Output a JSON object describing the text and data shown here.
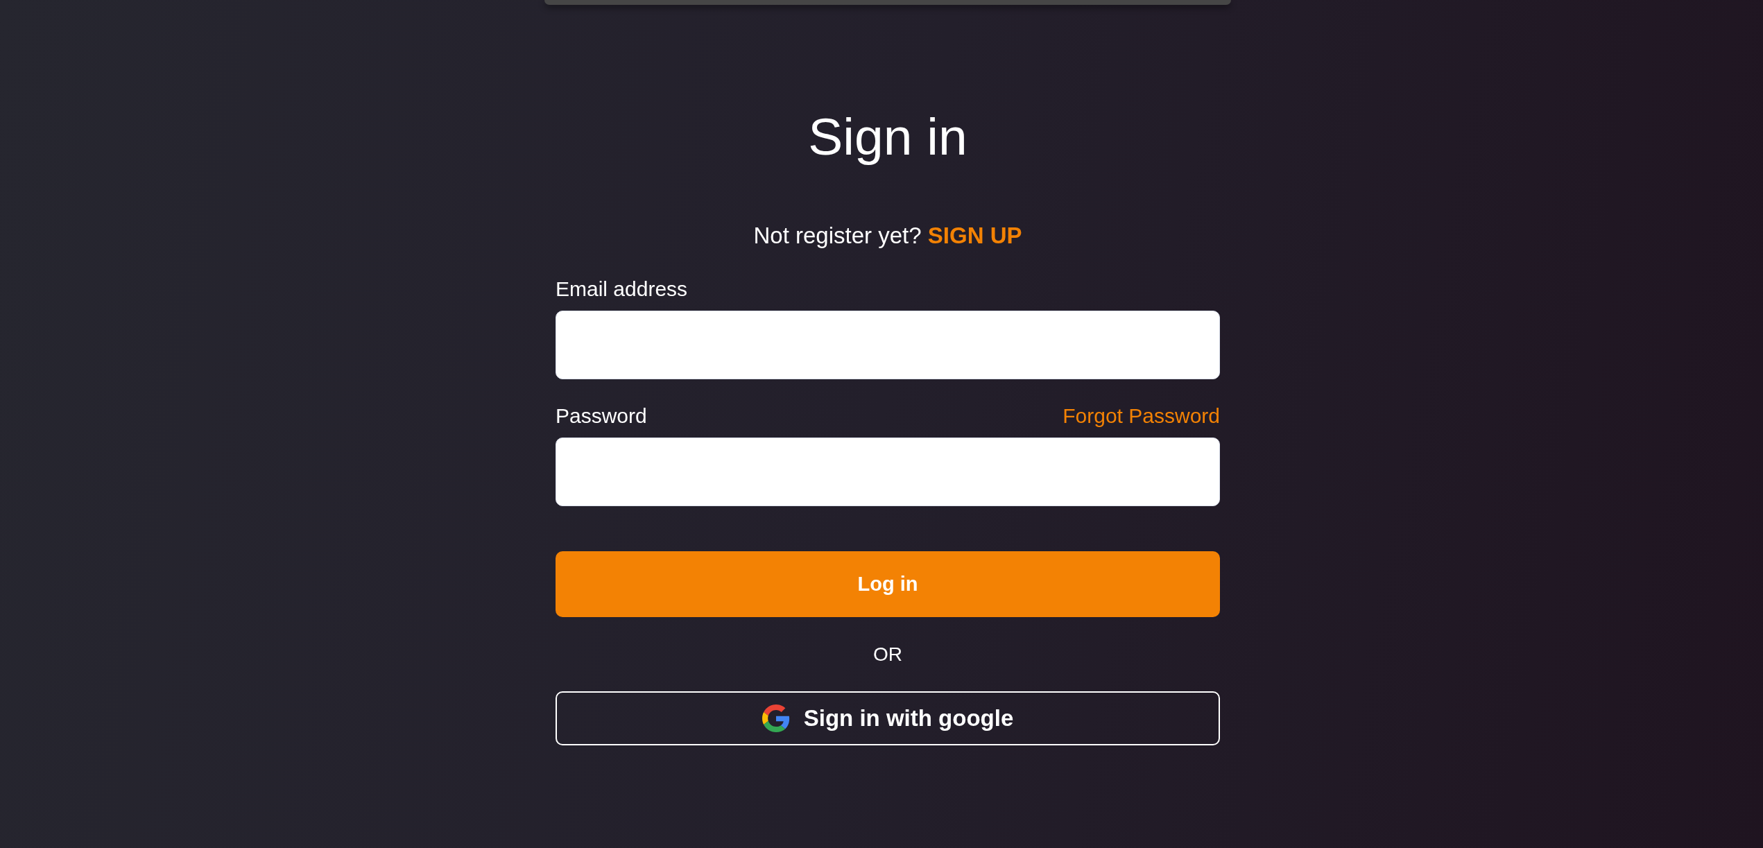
{
  "title": "Sign in",
  "signup_prompt": {
    "text": "Not register yet?",
    "link": "SIGN UP"
  },
  "fields": [
    {
      "label": "Email address"
    },
    {
      "label": "Password",
      "link": "Forgot Password"
    }
  ],
  "login_button": "Log in",
  "divider": "OR",
  "google_button": "Sign in with google"
}
